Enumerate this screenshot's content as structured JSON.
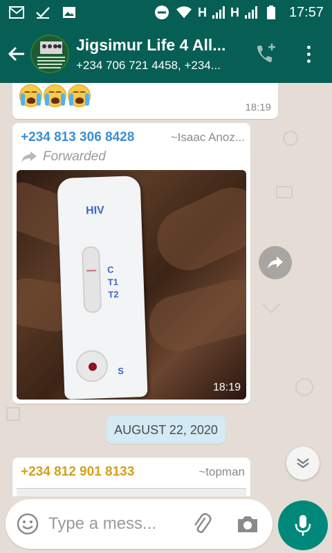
{
  "status_bar": {
    "network_labels": [
      "H",
      "H"
    ],
    "time": "17:57",
    "icons": [
      "gmail-icon",
      "check-icon",
      "image-icon",
      "dnd-icon",
      "wifi-icon",
      "signal-icon",
      "battery-icon"
    ]
  },
  "header": {
    "title": "Jigsimur Life 4 All...",
    "subtitle": "+234 706 721 4458, +234..."
  },
  "messages": [
    {
      "type": "emoji",
      "content": "😰😰😰",
      "time": "18:19"
    },
    {
      "type": "image",
      "sender_phone": "+234 813 306 8428",
      "sender_nick": "~Isaac Anoz...",
      "forwarded_label": "Forwarded",
      "photo_texts": {
        "hiv": "HIV",
        "c": "C",
        "t1": "T1",
        "t2": "T2",
        "s": "S"
      },
      "time": "18:19"
    },
    {
      "type": "date",
      "label": "AUGUST 22, 2020"
    },
    {
      "type": "partial",
      "sender_phone": "+234 812 901 8133",
      "sender_nick": "~topman"
    }
  ],
  "input": {
    "placeholder": "Type a mess..."
  },
  "colors": {
    "primary": "#075e54",
    "accent": "#00897b",
    "chat_bg": "#e5ddd5",
    "sender1": "#3a8ed4",
    "sender2": "#d4a01a"
  }
}
